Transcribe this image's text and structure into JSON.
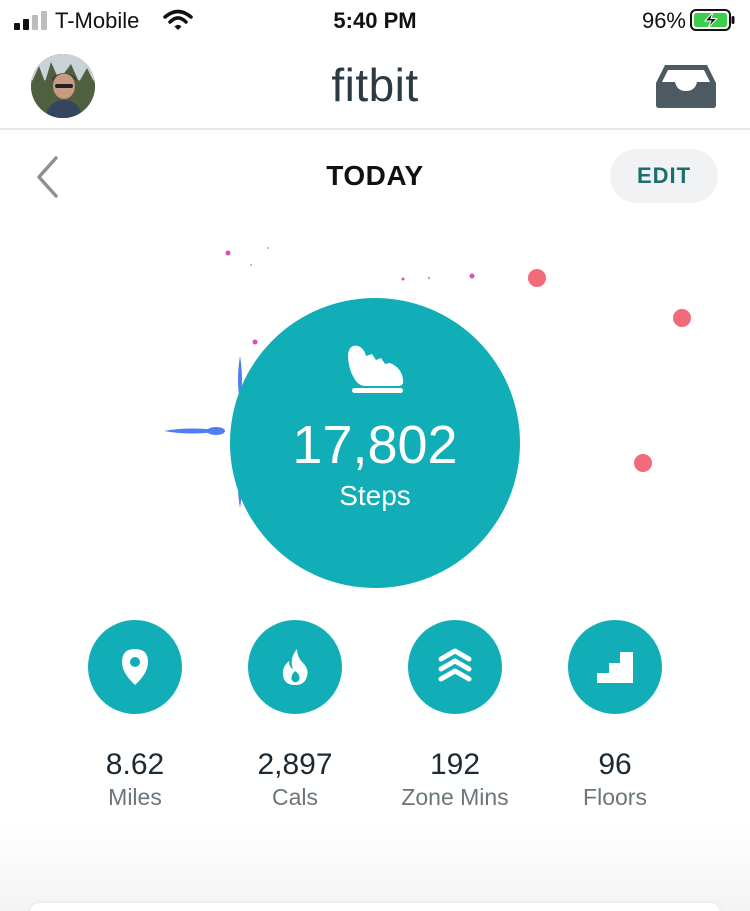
{
  "status_bar": {
    "carrier": "T-Mobile",
    "time": "5:40 PM",
    "battery_percent": "96%",
    "icons": [
      "signal-icon",
      "wifi-icon",
      "battery-charging-icon"
    ]
  },
  "header": {
    "logo_text": "fitbit",
    "avatar": "profile-avatar",
    "right_icon": "inbox-icon"
  },
  "nav": {
    "title": "TODAY",
    "edit_label": "EDIT",
    "back_icon": "chevron-left-icon"
  },
  "steps": {
    "value": "17,802",
    "label": "Steps",
    "icon": "shoe-icon"
  },
  "stats": [
    {
      "value": "8.62",
      "label": "Miles",
      "icon": "location-pin-icon"
    },
    {
      "value": "2,897",
      "label": "Cals",
      "icon": "flame-icon"
    },
    {
      "value": "192",
      "label": "Zone Mins",
      "icon": "chevrons-up-icon"
    },
    {
      "value": "96",
      "label": "Floors",
      "icon": "stairs-icon"
    }
  ],
  "colors": {
    "accent_teal": "#12aeb8",
    "edit_text": "#1b6f73",
    "confetti_pink": "#f26b7a",
    "confetti_magenta": "#d94fb4",
    "confetti_blue": "#4f7ef0"
  }
}
